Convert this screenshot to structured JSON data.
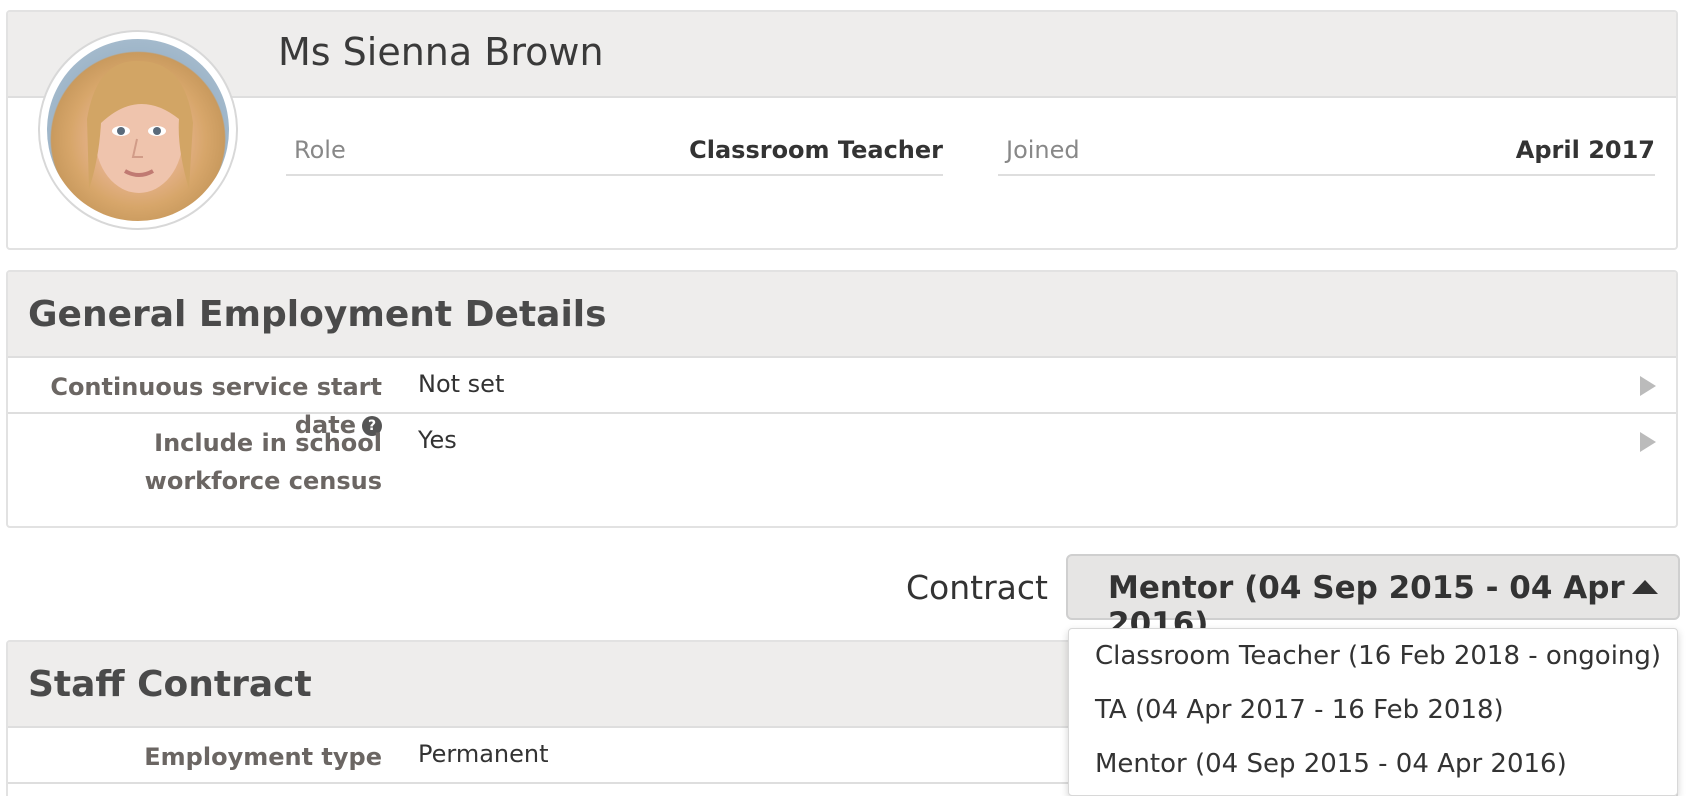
{
  "profile": {
    "name": "Ms Sienna Brown",
    "role_label": "Role",
    "role_value": "Classroom Teacher",
    "joined_label": "Joined",
    "joined_value": "April 2017"
  },
  "employment": {
    "title": "General Employment Details",
    "rows": [
      {
        "label": "Continuous service start date",
        "value": "Not set",
        "has_help": true
      },
      {
        "label": "Include in school workforce census",
        "value": "Yes"
      }
    ]
  },
  "contract": {
    "label": "Contract",
    "selected": "Mentor (04 Sep 2015 - 04 Apr 2016)",
    "options": [
      "Classroom Teacher (16 Feb 2018 - ongoing)",
      "TA (04 Apr 2017 - 16 Feb 2018)",
      "Mentor (04 Sep 2015 - 04 Apr 2016)"
    ]
  },
  "staff_contract": {
    "title": "Staff Contract",
    "rows": [
      {
        "label": "Employment type",
        "value": "Permanent"
      }
    ]
  },
  "icons": {
    "help": "?",
    "row_arrow": "chevron-right-icon",
    "dropdown_caret": "caret-up-icon"
  }
}
